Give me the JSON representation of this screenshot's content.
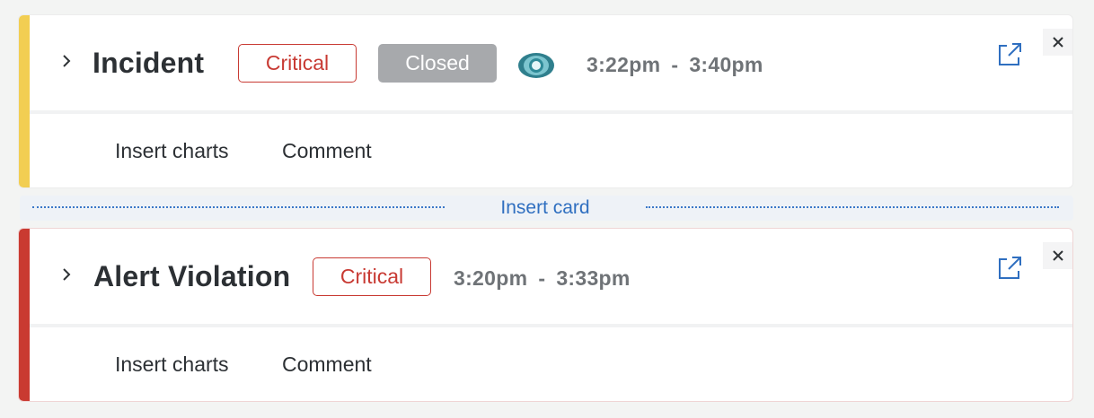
{
  "colors": {
    "incident_stripe": "#f2ce52",
    "alert_stripe": "#c93a31",
    "critical": "#c83a33",
    "closed_badge": "#a7a9ac",
    "link_blue": "#2f6fc0"
  },
  "cards": [
    {
      "title": "Incident",
      "severity": "Critical",
      "status": "Closed",
      "status_icon": "eye-icon",
      "time_start": "3:22pm",
      "time_separator": "-",
      "time_end": "3:40pm",
      "actions": [
        "Insert charts",
        "Comment"
      ],
      "icons": [
        "chevron-right-icon",
        "external-link-icon",
        "close-icon"
      ]
    },
    {
      "title": "Alert Violation",
      "severity": "Critical",
      "time_start": "3:20pm",
      "time_separator": "-",
      "time_end": "3:33pm",
      "actions": [
        "Insert charts",
        "Comment"
      ],
      "icons": [
        "chevron-right-icon",
        "external-link-icon",
        "close-icon"
      ]
    }
  ],
  "insert_card": {
    "label": "Insert card"
  }
}
